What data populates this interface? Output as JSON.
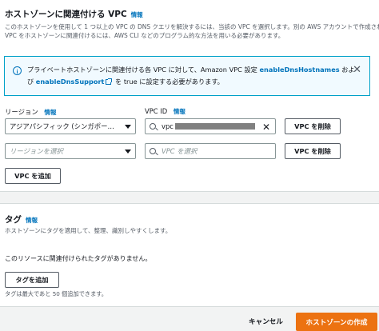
{
  "vpc_section": {
    "title": "ホストゾーンに関連付ける VPC",
    "info": "情報",
    "desc_lines": [
      "このホストゾーンを使用して 1 つ以上の VPC の DNS クエリを解決するには、当該の VPC を選択します。別の AWS アカウントで作成された",
      "VPC をホストゾーンに関連付けるには、AWS CLI などのプログラム的な方法を用いる必要があります。"
    ],
    "alert": {
      "line1_text": "プライベートホストゾーンに関連付ける各 VPC に対して、Amazon VPC 設定 ",
      "link1": "enableDnsHostnames",
      "line1_tail": " およ",
      "line2_head": "び ",
      "link2": "enableDnsSupport",
      "line2_tail": " を true に設定する必要があります。"
    },
    "region_label": "リージョン",
    "region_info": "情報",
    "vpcid_label": "VPC ID",
    "vpcid_info": "情報",
    "rows": [
      {
        "region": "アジアパシフィック (シンガポー…",
        "vpc": "vpc",
        "remove": "VPC を削除"
      },
      {
        "region_placeholder": "リージョンを選択",
        "vpc_placeholder": "VPC を選択",
        "remove": "VPC を削除"
      }
    ],
    "add_button": "VPC を追加"
  },
  "tag_section": {
    "title": "タグ",
    "info": "情報",
    "desc": "ホストゾーンにタグを適用して、整理、識別しやすくします。",
    "empty": "このリソースに関連付けられたタグがありません。",
    "add_button": "タグを追加",
    "limit": "タグは最大であと 50 個追加できます。"
  },
  "footer": {
    "cancel": "キャンセル",
    "create": "ホストゾーンの作成"
  },
  "colors": {
    "accent": "#0073bb",
    "primary_button": "#ec7211",
    "alert_bg": "#f1faff",
    "alert_border": "#00a1c9"
  }
}
